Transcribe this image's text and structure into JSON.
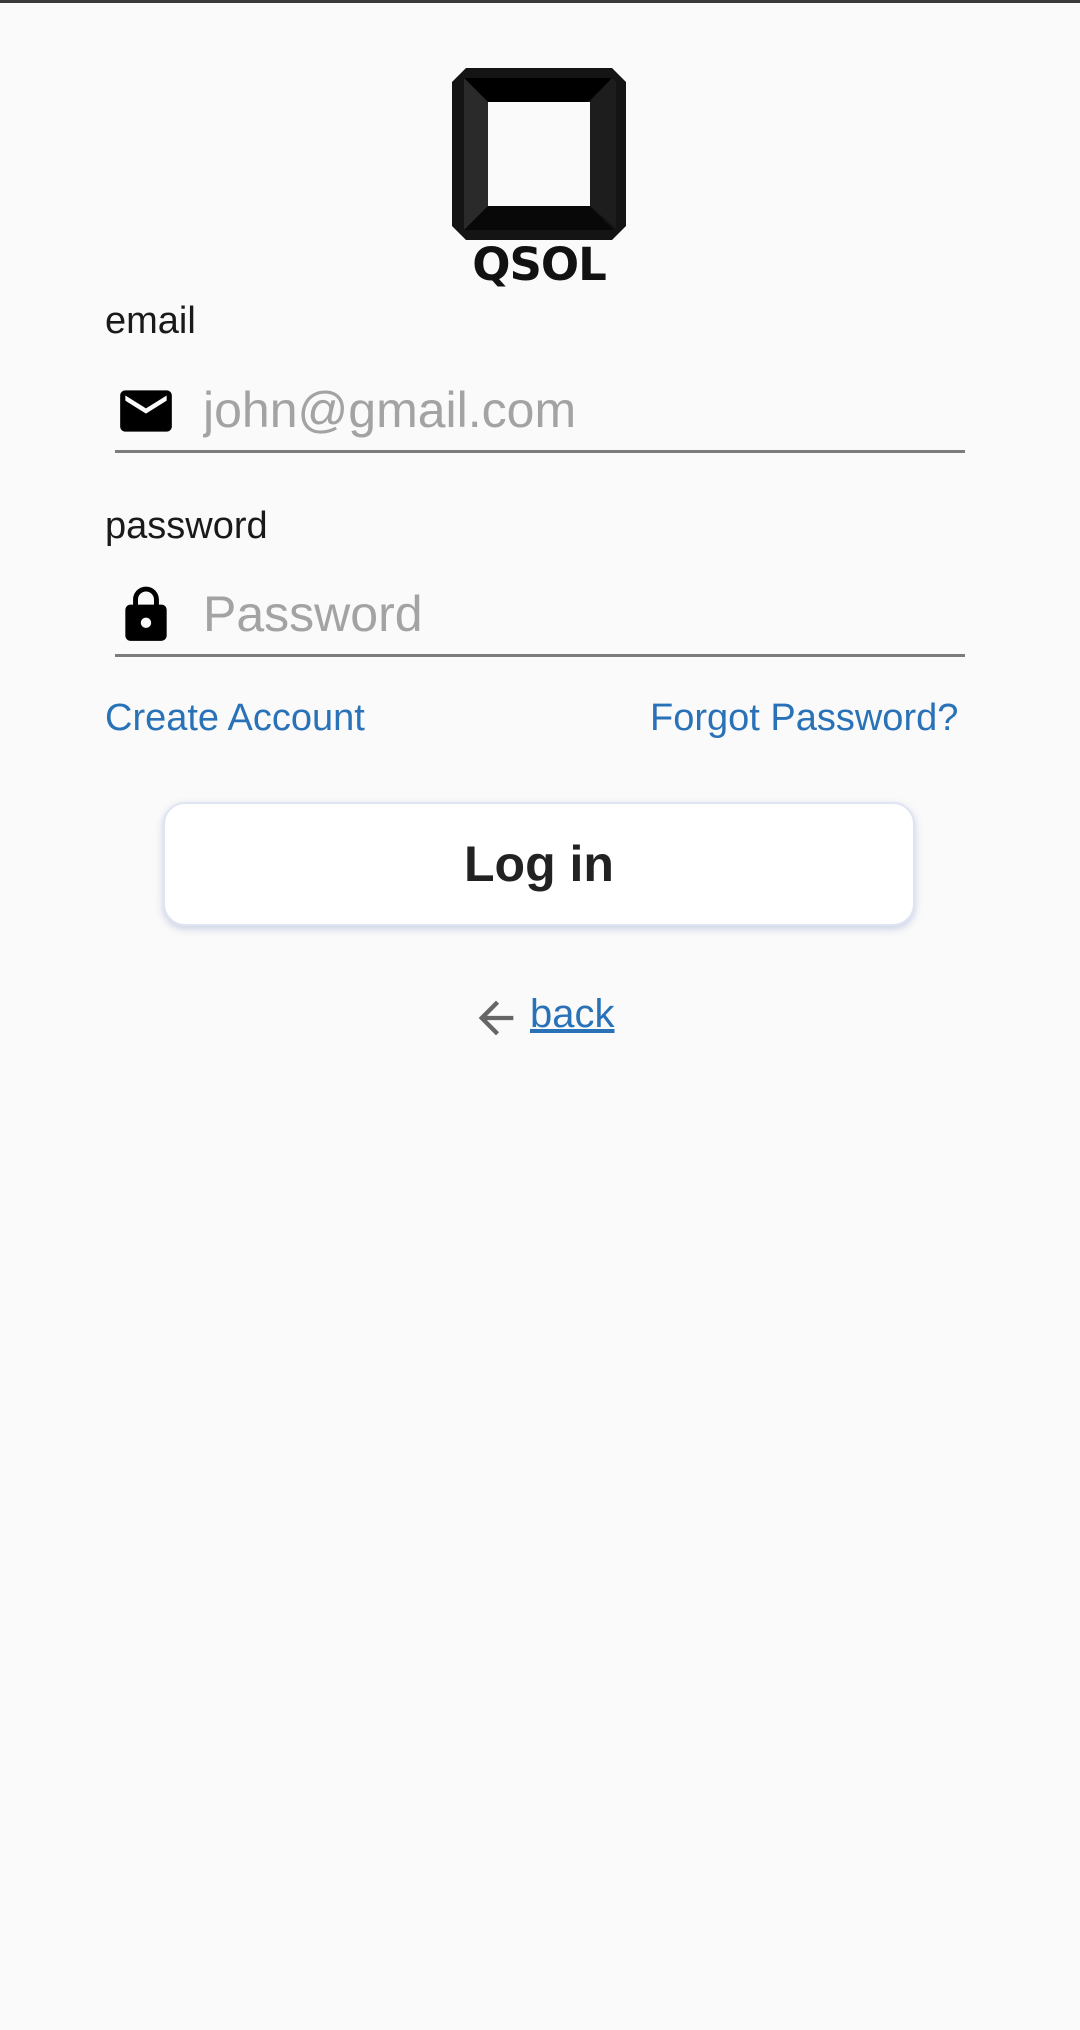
{
  "app": {
    "logo_text": "QSOL",
    "accent_color": "#2a72b8"
  },
  "login_form": {
    "email": {
      "label": "email",
      "placeholder": "john@gmail.com",
      "value": "",
      "icon": "mail-icon"
    },
    "password": {
      "label": "password",
      "placeholder": "Password",
      "value": "",
      "icon": "lock-icon"
    },
    "create_account_label": "Create Account",
    "forgot_password_label": "Forgot Password?",
    "login_button_label": "Log in"
  },
  "navigation": {
    "back_label": "back",
    "back_icon": "arrow-left-icon"
  }
}
